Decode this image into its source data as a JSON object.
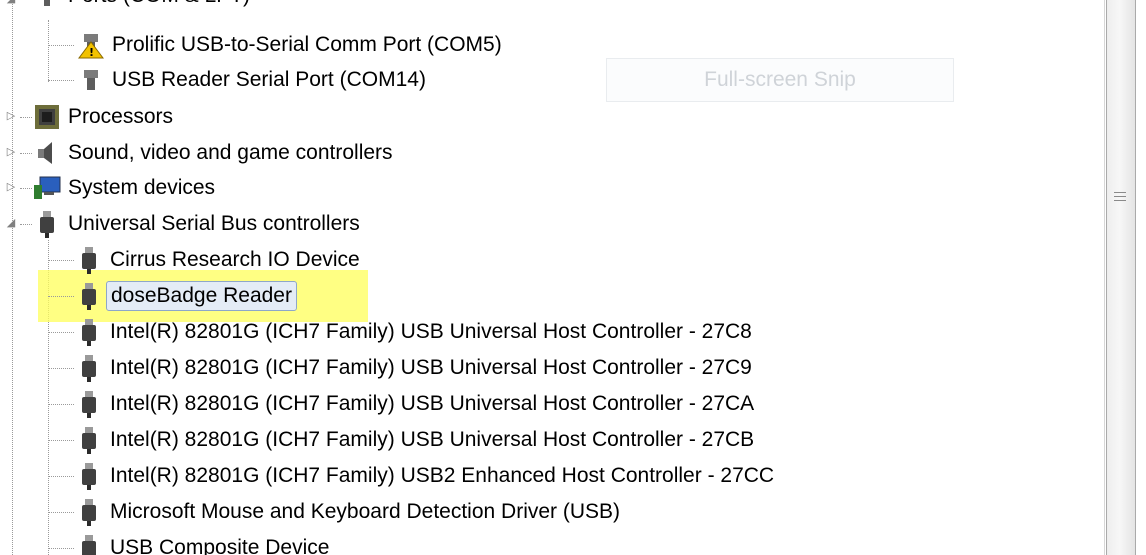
{
  "tree": {
    "ports_header_partial": "Ports (COM & LPT)",
    "ports": [
      {
        "label": "Prolific USB-to-Serial Comm Port (COM5)",
        "icon": "port-warning-icon"
      },
      {
        "label": "USB Reader Serial Port (COM14)",
        "icon": "port-icon"
      }
    ],
    "categories": [
      {
        "label": "Processors",
        "icon": "processor-icon",
        "expander": "▷"
      },
      {
        "label": "Sound, video and game controllers",
        "icon": "speaker-icon",
        "expander": "▷"
      },
      {
        "label": "System devices",
        "icon": "computer-icon",
        "expander": "▷"
      },
      {
        "label": "Universal Serial Bus controllers",
        "icon": "usb-plug-icon",
        "expander": "◢"
      }
    ],
    "usb_devices": [
      {
        "label": "Cirrus Research IO Device"
      },
      {
        "label": "doseBadge Reader",
        "highlighted": true
      },
      {
        "label": "Intel(R) 82801G (ICH7 Family) USB Universal Host Controller - 27C8"
      },
      {
        "label": "Intel(R) 82801G (ICH7 Family) USB Universal Host Controller - 27C9"
      },
      {
        "label": "Intel(R) 82801G (ICH7 Family) USB Universal Host Controller - 27CA"
      },
      {
        "label": "Intel(R) 82801G (ICH7 Family) USB Universal Host Controller - 27CB"
      },
      {
        "label": "Intel(R) 82801G (ICH7 Family) USB2 Enhanced Host Controller - 27CC"
      },
      {
        "label": "Microsoft Mouse and Keyboard Detection Driver (USB)"
      },
      {
        "label": "USB Composite Device"
      }
    ]
  },
  "overlay": {
    "snip_label": "Full-screen Snip"
  },
  "colors": {
    "highlight": "#ffff5a",
    "selection_border": "#8ea7c9"
  }
}
